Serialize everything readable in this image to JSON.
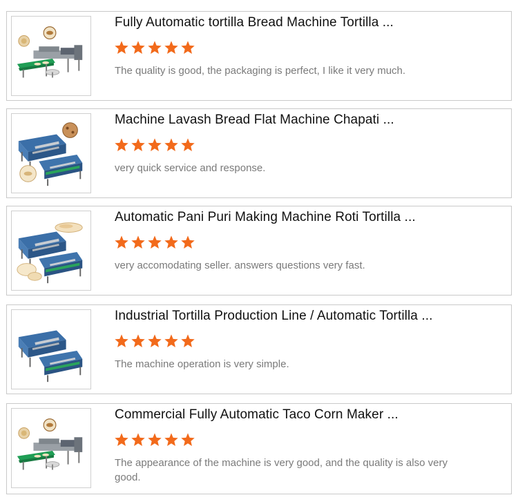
{
  "reviews": [
    {
      "title": "Fully Automatic tortilla Bread Machine Tortilla ...",
      "rating": 5,
      "comment": "The quality is good, the packaging is perfect, I like it very much.",
      "thumbnail": "tortilla-machine-green-conveyor"
    },
    {
      "title": "Machine Lavash Bread Flat Machine Chapati ...",
      "rating": 5,
      "comment": "very quick service and response.",
      "thumbnail": "lavash-machine-blue-press"
    },
    {
      "title": "Automatic Pani Puri Making Machine Roti Tortilla ...",
      "rating": 5,
      "comment": "very accomodating seller. answers questions very fast.",
      "thumbnail": "pani-puri-machine-blue-press"
    },
    {
      "title": "Industrial Tortilla Production Line / Automatic Tortilla ...",
      "rating": 5,
      "comment": "The machine operation is very simple.",
      "thumbnail": "tortilla-production-line-blue"
    },
    {
      "title": "Commercial Fully Automatic Taco Corn Maker ...",
      "rating": 5,
      "comment": "The appearance of the machine is very good, and the quality is also very good.",
      "thumbnail": "taco-maker-green-conveyor"
    }
  ],
  "colors": {
    "star": "#f26a1b",
    "border": "#c9c9c9",
    "title": "#111111",
    "comment": "#7a7a7a"
  }
}
